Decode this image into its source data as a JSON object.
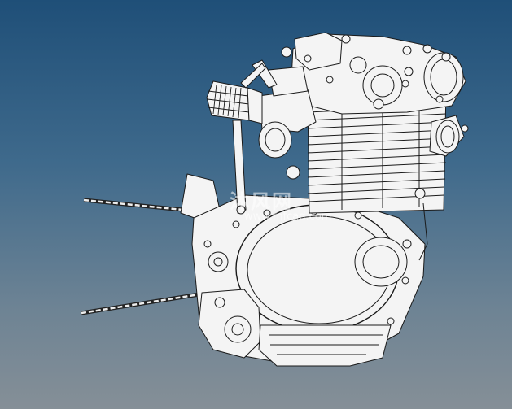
{
  "viewport": {
    "background_top": "#1f4f78",
    "background_bottom": "#858f97"
  },
  "watermark": {
    "logo_text": "沐风网",
    "url_text": "www.mfcad.com"
  },
  "model": {
    "part_color": "#f4f4f4",
    "edge_color": "#1a1a1a"
  }
}
